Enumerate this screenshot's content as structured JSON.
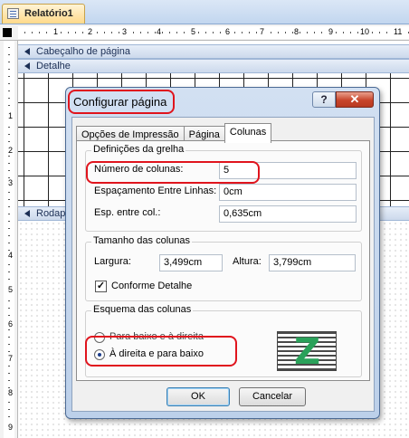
{
  "document": {
    "tab_title": "Relatório1",
    "ruler_top_numbers": [
      "1",
      "2",
      "3",
      "4",
      "5",
      "6",
      "7",
      "8",
      "9",
      "10",
      "11"
    ],
    "ruler_left_numbers": [
      "1",
      "2",
      "3",
      "4",
      "5",
      "6",
      "7",
      "8",
      "9"
    ],
    "sections": {
      "page_header": "Cabeçalho de página",
      "detail": "Detalhe",
      "footer": "Rodap"
    }
  },
  "dialog": {
    "title": "Configurar página",
    "help_label": "?",
    "close_label": "✕",
    "tabs": [
      "Opções de Impressão",
      "Página",
      "Colunas"
    ],
    "active_tab": "Colunas",
    "grid_group": {
      "title": "Definições da grelha",
      "columns_label": "Número de colunas:",
      "columns_value": "5",
      "row_spacing_label": "Espaçamento Entre Linhas:",
      "row_spacing_value": "0cm",
      "column_spacing_label": "Esp. entre col.:",
      "column_spacing_value": "0,635cm"
    },
    "size_group": {
      "title": "Tamanho das colunas",
      "width_label": "Largura:",
      "width_value": "3,499cm",
      "height_label": "Altura:",
      "height_value": "3,799cm",
      "same_as_detail_label": "Conforme Detalhe",
      "same_as_detail_checked": true
    },
    "layout_group": {
      "title": "Esquema das colunas",
      "option_down_then_across": "Para baixo e à direita",
      "option_across_then_down": "À direita e para baixo",
      "selected": "À direita e para baixo"
    },
    "ok_label": "OK",
    "cancel_label": "Cancelar"
  },
  "colors": {
    "annotation": "#e0141d",
    "dialog_frame": "#bcd0ea",
    "pattern_arrow": "#2aa15a"
  }
}
